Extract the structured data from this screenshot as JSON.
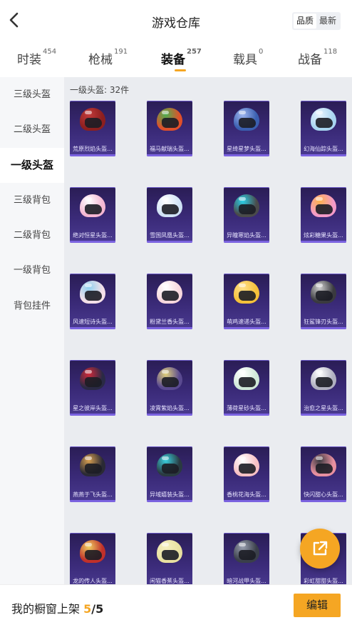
{
  "header": {
    "title": "游戏仓库",
    "back_icon": "chevron-left-icon",
    "sort_options": [
      "品质",
      "最新"
    ],
    "sort_selected": "品质"
  },
  "tabs": [
    {
      "label": "时装",
      "count": "454"
    },
    {
      "label": "枪械",
      "count": "191"
    },
    {
      "label": "装备",
      "count": "257",
      "active": true
    },
    {
      "label": "载具",
      "count": "0"
    },
    {
      "label": "战备",
      "count": "118"
    }
  ],
  "sidebar": {
    "items": [
      "三级头盔",
      "二级头盔",
      "一级头盔",
      "三级背包",
      "二级背包",
      "一级背包",
      "背包挂件"
    ],
    "active_index": 2
  },
  "main": {
    "section_title": "一级头盔: 32件",
    "items": [
      {
        "label": "荒原烈焰头盔...",
        "shell": "#8c1f1f",
        "accent": "#c23b3b"
      },
      {
        "label": "福马献瑞头盔...",
        "shell": "#e0502a",
        "accent": "#4caf50"
      },
      {
        "label": "星绮星梦头盔...",
        "shell": "#3a5fb0",
        "accent": "#9fb7f0"
      },
      {
        "label": "幻海仙踪头盔...",
        "shell": "#a8d4f0",
        "accent": "#e8f4ff"
      },
      {
        "label": "绝对恒星头盔...",
        "shell": "#f4b6d2",
        "accent": "#ffffff"
      },
      {
        "label": "雪国凤凰头盔...",
        "shell": "#cfe2f5",
        "accent": "#ffffff"
      },
      {
        "label": "异瞳寒焰头盔...",
        "shell": "#4a4a4a",
        "accent": "#2bd0e8"
      },
      {
        "label": "炫彩糖果头盔...",
        "shell": "#f39ac8",
        "accent": "#ffb24a"
      },
      {
        "label": "风速短诗头盔...",
        "shell": "#f4e0e8",
        "accent": "#8fd0f0"
      },
      {
        "label": "粉黛兰香头盔...",
        "shell": "#f7d7dd",
        "accent": "#ffffff"
      },
      {
        "label": "萌鸡速递头盔...",
        "shell": "#f5c13a",
        "accent": "#ffe08a"
      },
      {
        "label": "狂鲨锋刃头盔...",
        "shell": "#3a3a3f",
        "accent": "#d0d0d0"
      },
      {
        "label": "星之彼岸头盔...",
        "shell": "#2a2a45",
        "accent": "#d02a3a"
      },
      {
        "label": "凌霄紫焰头盔...",
        "shell": "#5a4a90",
        "accent": "#e0d07a"
      },
      {
        "label": "薄荷星砂头盔...",
        "shell": "#cfe8d8",
        "accent": "#ffffff"
      },
      {
        "label": "治愈之星头盔...",
        "shell": "#b0b0c0",
        "accent": "#ffffff"
      },
      {
        "label": "燕燕于飞头盔...",
        "shell": "#2a2a35",
        "accent": "#d9a050"
      },
      {
        "label": "异域嬉装头盔...",
        "shell": "#2a3a40",
        "accent": "#3ad0e0"
      },
      {
        "label": "香桃花海头盔...",
        "shell": "#f7c0c4",
        "accent": "#ffffff"
      },
      {
        "label": "快闪甜心头盔...",
        "shell": "#e890a0",
        "accent": "#3a3a40"
      },
      {
        "label": "龙的传人头盔...",
        "shell": "#c0302a",
        "accent": "#f0d060"
      },
      {
        "label": "闲猫香蕉头盔...",
        "shell": "#e8e0a0",
        "accent": "#f5f0c0"
      },
      {
        "label": "暗河战甲头盔...",
        "shell": "#3a3f4a",
        "accent": "#9aa0b0"
      },
      {
        "label": "彩虹甜甜头盔...",
        "shell": "#e8c0d8",
        "accent": "#a0d0f0"
      }
    ]
  },
  "fab": {
    "icon": "share-external-icon"
  },
  "bottom": {
    "shelf_label": "我的橱窗上架",
    "shelf_count": "5",
    "shelf_total": "/5",
    "edit_label": "编辑"
  },
  "colors": {
    "accent": "#f5a623",
    "card_bg": "#3a2a78",
    "content_bg": "#eaecf0"
  }
}
